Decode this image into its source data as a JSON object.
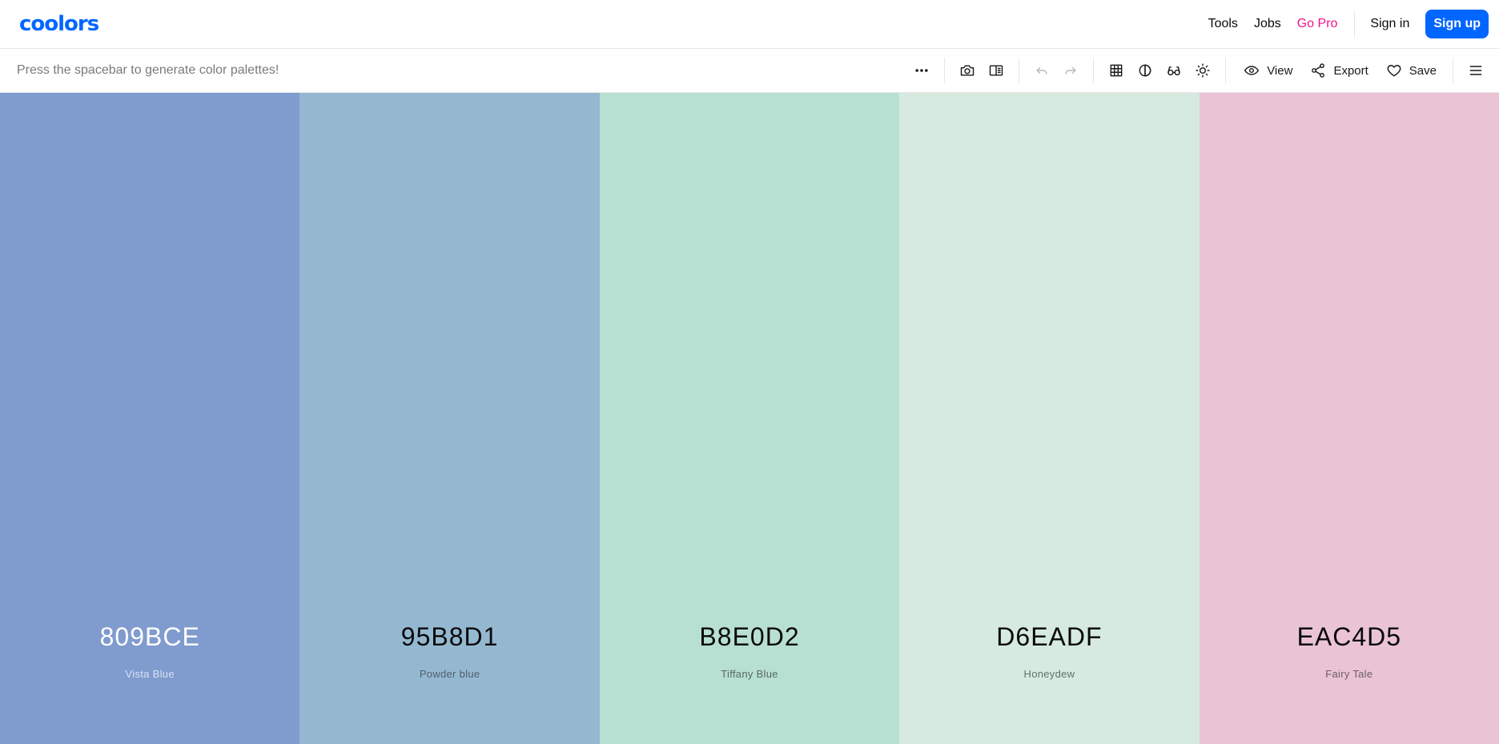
{
  "header": {
    "logo": "coolors",
    "nav": {
      "tools": "Tools",
      "jobs": "Jobs",
      "gopro": "Go Pro",
      "signin": "Sign in",
      "signup": "Sign up"
    },
    "colors": {
      "brand": "#0066ff",
      "gopro": "#f0148c"
    }
  },
  "toolbar": {
    "hint": "Press the spacebar to generate color palettes!",
    "icons": [
      "more-horizontal-icon",
      "camera-icon",
      "panel-icon",
      "undo-icon",
      "redo-icon",
      "grid-icon",
      "contrast-icon",
      "glasses-icon",
      "sun-icon",
      "eye-icon",
      "share-icon",
      "heart-icon",
      "menu-icon"
    ],
    "view_label": "View",
    "export_label": "Export",
    "save_label": "Save"
  },
  "palette": {
    "swatches": [
      {
        "hex": "809BCE",
        "name": "Vista Blue",
        "bg": "#809BCE",
        "hex_color": "#ffffff",
        "name_color": "#d9e1f2"
      },
      {
        "hex": "95B8D1",
        "name": "Powder blue",
        "bg": "#95B8D1",
        "hex_color": "#0a0a0a",
        "name_color": "#4f5f6b"
      },
      {
        "hex": "B8E0D2",
        "name": "Tiffany Blue",
        "bg": "#B8E0D2",
        "hex_color": "#0a0a0a",
        "name_color": "#566962"
      },
      {
        "hex": "D6EADF",
        "name": "Honeydew",
        "bg": "#D6EADF",
        "hex_color": "#0a0a0a",
        "name_color": "#62706a"
      },
      {
        "hex": "EAC4D5",
        "name": "Fairy Tale",
        "bg": "#EAC4D5",
        "hex_color": "#0a0a0a",
        "name_color": "#6e5d65"
      }
    ]
  }
}
